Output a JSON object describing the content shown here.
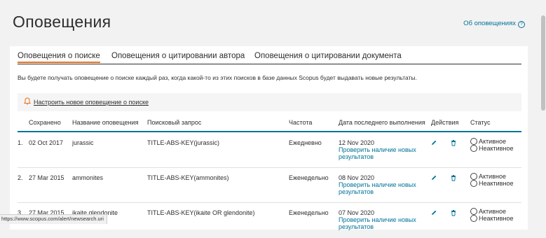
{
  "page": {
    "title": "Оповещения",
    "about_link": "Об оповещениях",
    "about_icon": "?"
  },
  "tabs": [
    {
      "label": "Оповещения о поиске",
      "active": true
    },
    {
      "label": "Оповещения о цитировании автора",
      "active": false
    },
    {
      "label": "Оповещения о цитировании документа",
      "active": false
    }
  ],
  "description": "Вы будете получать оповещение о поиске каждый раз, когда какой-то из этих поисков в базе данных Scopus будет выдавать новые результаты.",
  "new_alert": {
    "label": "Настроить новое оповещение о поиске",
    "icon": "bell-icon"
  },
  "table": {
    "headers": {
      "saved": "Сохранено",
      "name": "Название оповещения",
      "query": "Поисковый запрос",
      "frequency": "Частота",
      "last_run": "Дата последнего выполнения",
      "actions": "Действия",
      "status": "Статус"
    },
    "check_link_line1": "Проверить наличие новых",
    "check_link_line2": "результатов",
    "status_active": "Активное",
    "status_inactive": "Неактивное",
    "rows": [
      {
        "num": "1.",
        "saved": "02 Oct 2017",
        "name": "jurassic",
        "query": "TITLE-ABS-KEY(jurassic)",
        "frequency": "Ежедневно",
        "last_run": "12 Nov 2020"
      },
      {
        "num": "2.",
        "saved": "27 Mar 2015",
        "name": "ammonites",
        "query": "TITLE-ABS-KEY(ammonites)",
        "frequency": "Еженедельно",
        "last_run": "08 Nov 2020"
      },
      {
        "num": "3.",
        "saved": "27 Mar 2015",
        "name": "ikaite glendonite",
        "query": "TITLE-ABS-KEY(ikaite OR glendonite)",
        "frequency": "Еженедельно",
        "last_run": "07 Nov 2020"
      }
    ]
  },
  "status_bar": {
    "url": "https://www.scopus.com/alert/newsearch.uri"
  },
  "colors": {
    "accent_orange": "#e9711c",
    "link_blue": "#007398",
    "background": "#f2f2f2"
  }
}
